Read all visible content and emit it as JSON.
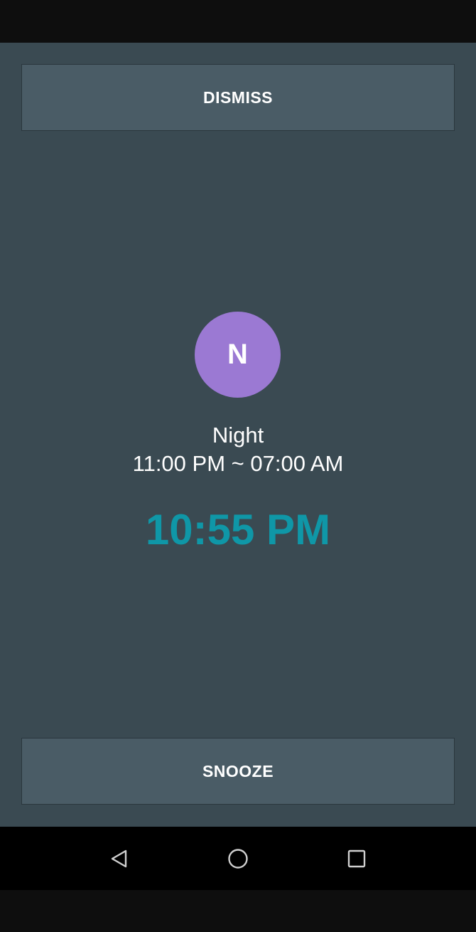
{
  "buttons": {
    "dismiss_label": "DISMISS",
    "snooze_label": "SNOOZE"
  },
  "alarm": {
    "avatar_letter": "N",
    "name": "Night",
    "range": "11:00 PM ~ 07:00 AM",
    "current_time": "10:55 PM"
  },
  "colors": {
    "background": "#3a4a52",
    "button": "#4a5c66",
    "avatar": "#9b79d3",
    "time_accent": "#0f97a7"
  },
  "nav": {
    "icons": [
      "back-icon",
      "home-icon",
      "recents-icon"
    ]
  }
}
